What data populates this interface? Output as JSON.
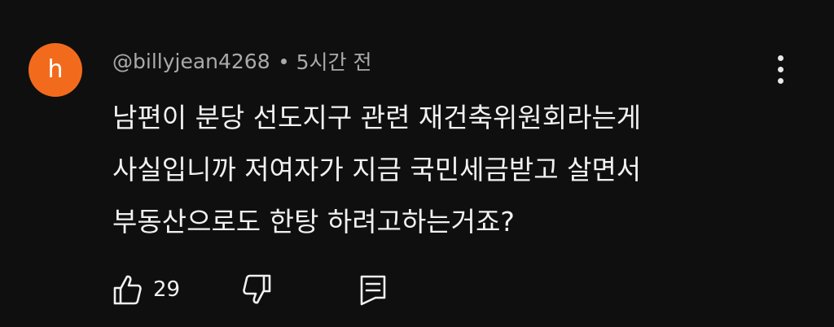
{
  "comment": {
    "avatar_letter": "h",
    "avatar_color": "#f26b1d",
    "author": "@billyjean4268",
    "time_ago": "5시간 전",
    "text_lines": [
      "남편이 분당 선도지구 관련 재건축위원회라는게",
      "사실입니까 저여자가 지금 국민세금받고 살면서",
      "부동산으로도 한탕 하려고하는거죠?"
    ],
    "like_count": "29"
  },
  "icons": {
    "like": "thumbs-up-icon",
    "dislike": "thumbs-down-icon",
    "reply": "comment-reply-icon",
    "more": "more-vertical-icon"
  }
}
